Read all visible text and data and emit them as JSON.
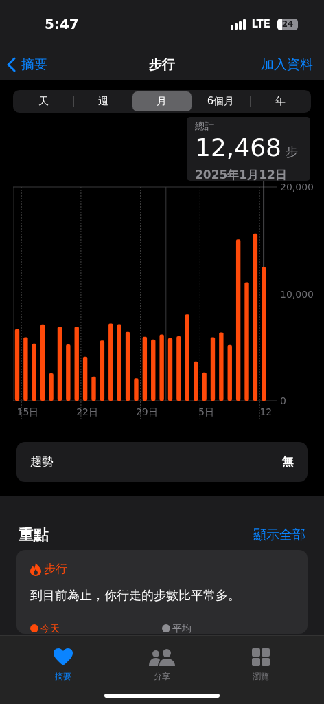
{
  "status_bar": {
    "time": "5:47",
    "network": "LTE",
    "battery": "24"
  },
  "nav": {
    "back": "摘要",
    "title": "步行",
    "action": "加入資料"
  },
  "segments": [
    {
      "label": "天",
      "selected": false
    },
    {
      "label": "週",
      "selected": false
    },
    {
      "label": "月",
      "selected": true
    },
    {
      "label": "6個月",
      "selected": false
    },
    {
      "label": "年",
      "selected": false
    }
  ],
  "tooltip": {
    "label": "總計",
    "value": "12,468",
    "unit": "步",
    "date": "2025年1月12日"
  },
  "chart_data": {
    "type": "bar",
    "categories": [
      null,
      "15日",
      null,
      null,
      null,
      null,
      null,
      null,
      "22日",
      null,
      null,
      null,
      null,
      null,
      null,
      "29日",
      null,
      null,
      null,
      null,
      null,
      null,
      "5日",
      null,
      null,
      null,
      null,
      null,
      null,
      "12"
    ],
    "series": [
      {
        "color": "#ff4a0a",
        "values": [
          6700,
          5950,
          5350,
          7150,
          2570,
          6940,
          5270,
          6940,
          4130,
          2270,
          5650,
          7240,
          7170,
          6450,
          2100,
          6000,
          5740,
          6210,
          5870,
          6040,
          8090,
          3680,
          2660,
          5950,
          6400,
          5220,
          15100,
          11100,
          15650,
          12500
        ]
      }
    ],
    "ylim": [
      0,
      20000
    ],
    "yticks": [
      {
        "value": 0,
        "label": "0"
      },
      {
        "value": 10000,
        "label": "10,000"
      },
      {
        "value": 20000,
        "label": "20,000"
      }
    ]
  },
  "trend": {
    "label": "趨勢",
    "value": "無"
  },
  "highlights": {
    "title": "重點",
    "link": "顯示全部",
    "card": {
      "category": "步行",
      "text": "到目前為止，你行走的步數比平常多。",
      "legend": [
        {
          "label": "今天",
          "color": "#ff4a0a"
        },
        {
          "label": "平均",
          "color": "#8e8e93"
        }
      ]
    }
  },
  "tab_bar": [
    {
      "label": "摘要",
      "kind": "heart",
      "selected": true
    },
    {
      "label": "分享",
      "kind": "people",
      "selected": false
    },
    {
      "label": "瀏覽",
      "kind": "grid",
      "selected": false
    }
  ]
}
